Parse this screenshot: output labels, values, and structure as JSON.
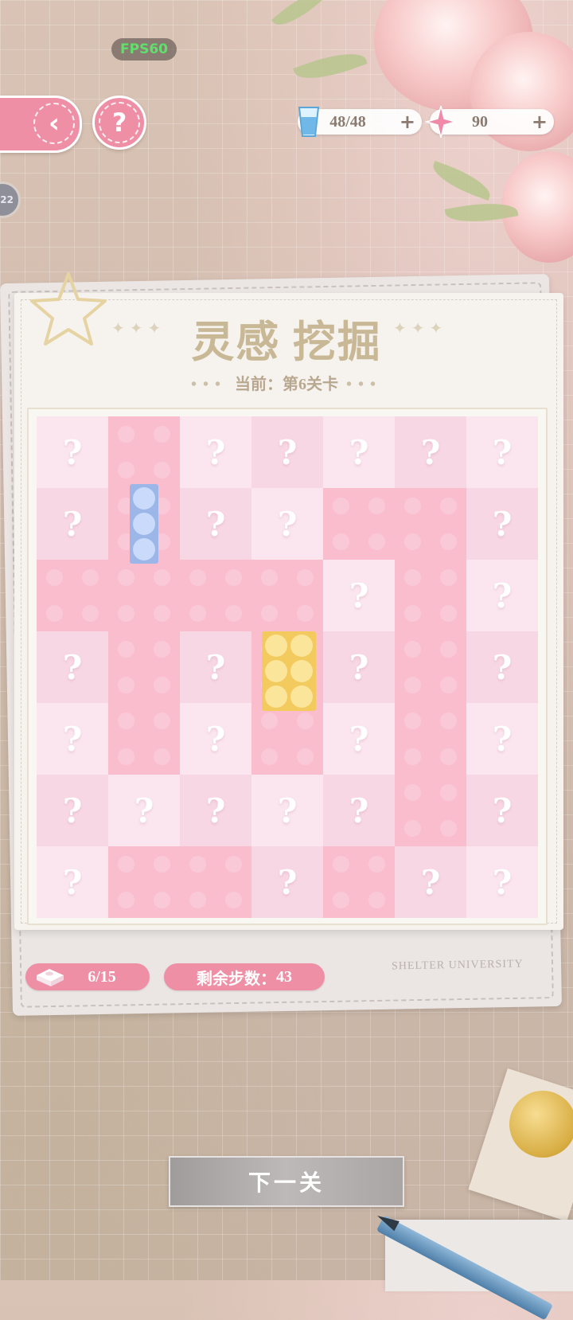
{
  "hud": {
    "fps": "FPS60",
    "side_badge": "22",
    "energy": {
      "value": "48/48",
      "plus": "+",
      "icon": "water-glass-icon",
      "color": "#6fb8e8"
    },
    "gems": {
      "value": "90",
      "plus": "+",
      "icon": "pink-star-gem-icon",
      "color": "#f08aa8"
    },
    "back_icon": "‹",
    "help_icon": "?"
  },
  "panel": {
    "title": "灵感 挖掘",
    "current_prefix": "当前：",
    "current_level": "第6关卡",
    "watermark": "SHELTER UNIVERSITY"
  },
  "board": {
    "rows": 7,
    "cols": 7,
    "hidden_symbol": "?",
    "cells": [
      [
        "h",
        "d",
        "h",
        "h",
        "h",
        "h",
        "h"
      ],
      [
        "h",
        "d",
        "h",
        "h",
        "d",
        "d",
        "h"
      ],
      [
        "d",
        "d",
        "d",
        "d",
        "h",
        "d",
        "h"
      ],
      [
        "h",
        "d",
        "h",
        "d",
        "h",
        "d",
        "h"
      ],
      [
        "h",
        "d",
        "h",
        "d",
        "h",
        "d",
        "h"
      ],
      [
        "h",
        "h",
        "h",
        "h",
        "h",
        "d",
        "h"
      ],
      [
        "h",
        "d",
        "d",
        "h",
        "d",
        "h",
        "h"
      ]
    ],
    "pieces": [
      {
        "name": "blue-block",
        "color": "blue",
        "row": 1,
        "col": 1,
        "stud_rows": 3,
        "stud_cols": 1
      },
      {
        "name": "yellow-block",
        "color": "yellow",
        "row": 3,
        "col": 3,
        "stud_rows": 3,
        "stud_cols": 2
      }
    ],
    "colors": {
      "dug": "#f9bdce",
      "hidden_light": "#fbe6ef",
      "hidden_mid": "#f8d7e4",
      "accent": "#ef8fa6"
    }
  },
  "status": {
    "blocks_found": "6/15",
    "blocks_icon": "brick-icon",
    "steps_label": "剩余步数：",
    "steps_value": "43"
  },
  "next_button": "下一关"
}
